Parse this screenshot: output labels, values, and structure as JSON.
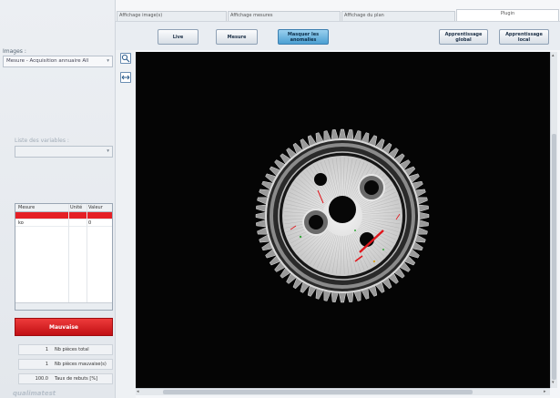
{
  "tabs": [
    {
      "label": "Affichage image(s)"
    },
    {
      "label": "Affichage mesures"
    },
    {
      "label": "Affichage du plan"
    },
    {
      "label": "Plugin"
    }
  ],
  "toolbar": {
    "live": "Live",
    "mesure": "Mesure",
    "masquer": "Masquer les\nanomalies",
    "apprentissage_global": "Apprentissage\nglobal",
    "apprentissage_local": "Apprentissage\nlocal"
  },
  "left": {
    "images_label": "Images :",
    "images_value": "Mesure - Acquisition annuaire All",
    "variables_label": "Liste des variables :",
    "variables_value": ""
  },
  "table": {
    "headers": [
      "Mesure",
      "Unité",
      "Valeur"
    ],
    "rows": [
      {
        "mesure": "",
        "unite": "",
        "valeur": ""
      },
      {
        "mesure": "ko",
        "unite": "",
        "valeur": "0"
      }
    ]
  },
  "status": {
    "label": "Mauvaise",
    "color": "#e51f25"
  },
  "stats": [
    {
      "value": "1",
      "label": "Nb pièces total"
    },
    {
      "value": "1",
      "label": "Nb pièces mauvaise(s)"
    },
    {
      "value": "100.0",
      "label": "Taux de rebuts [%]"
    }
  ],
  "brand": "qualimatest",
  "icons": {
    "zoom": "zoom-icon",
    "fit": "fit-screen-icon"
  }
}
